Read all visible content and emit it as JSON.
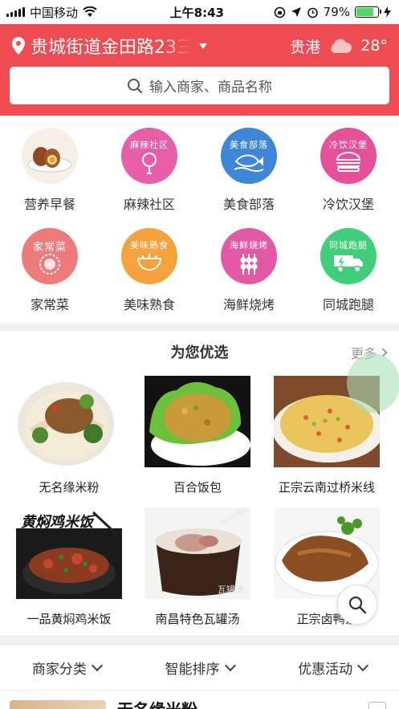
{
  "status_bar": {
    "carrier": "中国移动",
    "time": "上午8:43",
    "battery_percent": "79%",
    "battery_level": 0.79
  },
  "header": {
    "location": "贵城街道金田路23三",
    "city": "贵港",
    "temperature": "28°",
    "weather_icon": "cloud-icon",
    "search_placeholder": "输入商家、商品名称",
    "color": "#ee4b52"
  },
  "categories": [
    {
      "label": "营养早餐",
      "badge": "",
      "color": "#f6efe6"
    },
    {
      "label": "麻辣社区",
      "badge": "麻辣社区",
      "color": "#e85ea8"
    },
    {
      "label": "美食部落",
      "badge": "美食部落",
      "color": "#3e86d8"
    },
    {
      "label": "冷饮汉堡",
      "badge": "冷饮汉堡",
      "color": "#e6509a"
    },
    {
      "label": "家常菜",
      "badge": "家常菜",
      "color": "#ef7a7a"
    },
    {
      "label": "美味熟食",
      "badge": "美味熟食",
      "color": "#f3a23c"
    },
    {
      "label": "海鲜烧烤",
      "badge": "海鲜烧烤",
      "color": "#e25aa6"
    },
    {
      "label": "同城跑腿",
      "badge": "同城跑腿",
      "color": "#3fcf7a"
    }
  ],
  "recommend": {
    "title": "为您优选",
    "more": "更多",
    "items": [
      {
        "name": "无名缘米粉"
      },
      {
        "name": "百合饭包"
      },
      {
        "name": "正宗云南过桥米线"
      },
      {
        "name": "一品黄焖鸡米饭",
        "image_caption": "黄焖鸡米饭"
      },
      {
        "name": "南昌特色瓦罐汤",
        "image_caption": "瓦罐汤"
      },
      {
        "name": "正宗卤鸭饭"
      }
    ]
  },
  "filters": [
    {
      "label": "商家分类"
    },
    {
      "label": "智能排序"
    },
    {
      "label": "优惠活动"
    }
  ],
  "merchant_peek": {
    "name": "无名缘米粉"
  }
}
